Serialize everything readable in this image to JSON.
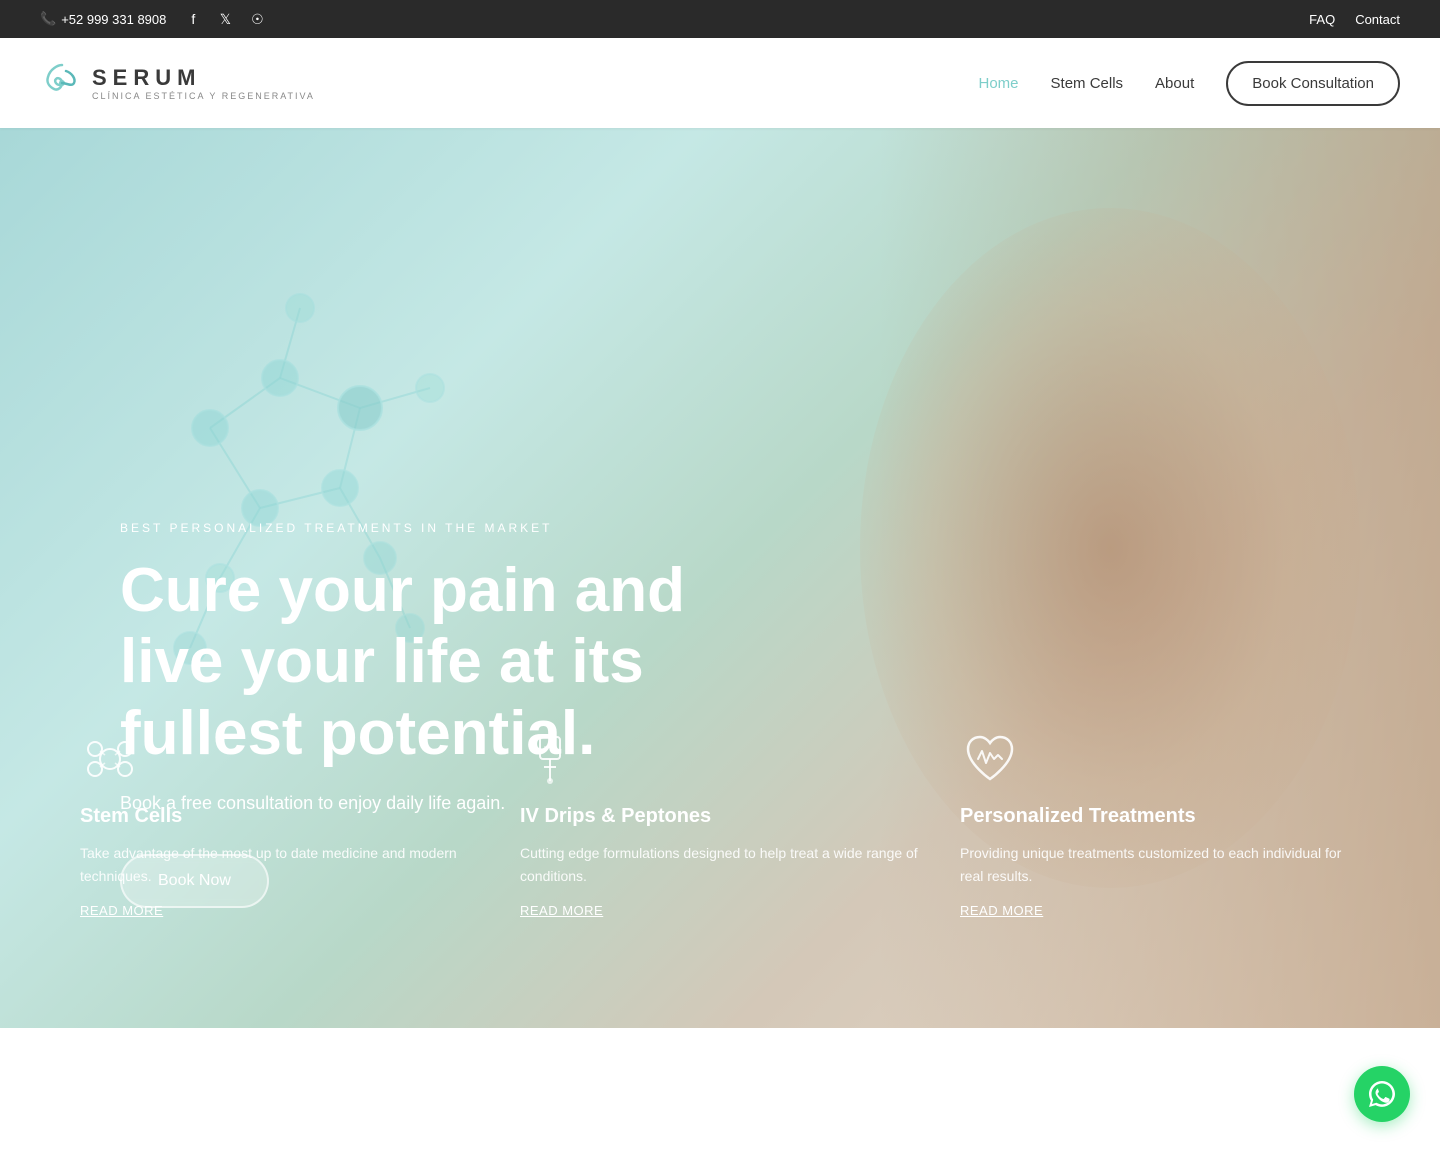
{
  "topbar": {
    "phone": "+52 999 331 8908",
    "faq": "FAQ",
    "contact": "Contact"
  },
  "navbar": {
    "logo_title": "SERUM",
    "logo_subtitle": "CLÍNICA ESTÉTICA Y REGENERATIVA",
    "nav": [
      {
        "label": "Home",
        "active": true
      },
      {
        "label": "Stem Cells",
        "active": false
      },
      {
        "label": "About",
        "active": false
      }
    ],
    "cta": "Book Consultation"
  },
  "hero": {
    "subtitle": "BEST PERSONALIZED TREATMENTS IN THE MARKET",
    "title": "Cure your pain and live your life at its fullest potential.",
    "desc": "Book a free consultation to enjoy daily life again.",
    "btn": "Book Now"
  },
  "services": [
    {
      "icon": "cells-icon",
      "title": "Stem Cells",
      "desc": "Take advantage of the most up to date medicine and modern techniques.",
      "link": "READ MORE"
    },
    {
      "icon": "iv-icon",
      "title": "IV Drips & Peptones",
      "desc": "Cutting edge formulations designed to help treat a wide range of conditions.",
      "link": "READ MORE"
    },
    {
      "icon": "heart-icon",
      "title": "Personalized Treatments",
      "desc": "Providing unique treatments customized to each individual for real results.",
      "link": "READ MORE"
    }
  ],
  "accent_color": "#7ececa",
  "whatsapp_bg": "#25D366"
}
